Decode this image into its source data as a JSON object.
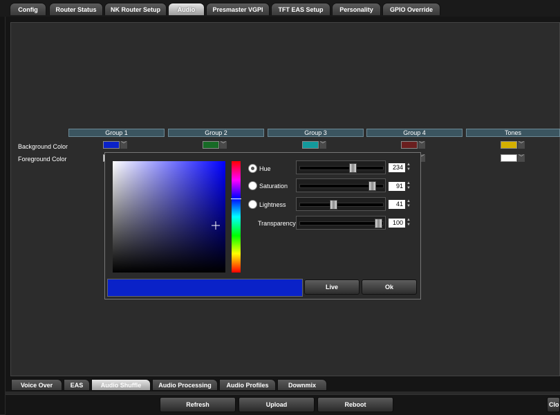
{
  "top_tabs": [
    {
      "label": "Config",
      "active": false
    },
    {
      "label": "Router Status",
      "active": false
    },
    {
      "label": "NK Router Setup",
      "active": false
    },
    {
      "label": "Audio",
      "active": true
    },
    {
      "label": "Presmaster VGPI",
      "active": false
    },
    {
      "label": "TFT EAS Setup",
      "active": false
    },
    {
      "label": "Personality",
      "active": false
    },
    {
      "label": "GPIO Override",
      "active": false
    }
  ],
  "groups": [
    "Group 1",
    "Group 2",
    "Group 3",
    "Group 4",
    "Tones"
  ],
  "rows": {
    "background_label": "Background Color",
    "foreground_label": "Foreground Color"
  },
  "swatches": {
    "background": [
      "#0a22c8",
      "#176a26",
      "#139a9c",
      "#6a1f1f",
      "#d4b000"
    ],
    "foreground": [
      "#ffffff",
      "#ffffff",
      "#ffffff",
      "#ffffff",
      "#ffffff"
    ]
  },
  "picker": {
    "selected_color": "#0a22c8",
    "mode": "Hue",
    "hue_label": "Hue",
    "hue_value": "234",
    "saturation_label": "Saturation",
    "saturation_value": "91",
    "lightness_label": "Lightness",
    "lightness_value": "41",
    "transparency_label": "Transparency",
    "transparency_value": "100",
    "live_label": "Live",
    "ok_label": "Ok"
  },
  "bottom_tabs": [
    {
      "label": "Voice Over",
      "active": false
    },
    {
      "label": "EAS",
      "active": false
    },
    {
      "label": "Audio Shuffle",
      "active": true
    },
    {
      "label": "Audio Processing",
      "active": false
    },
    {
      "label": "Audio Profiles",
      "active": false
    },
    {
      "label": "Downmix",
      "active": false
    }
  ],
  "footer": {
    "refresh_label": "Refresh",
    "upload_label": "Upload",
    "reboot_label": "Reboot",
    "close_label": "Clos"
  }
}
